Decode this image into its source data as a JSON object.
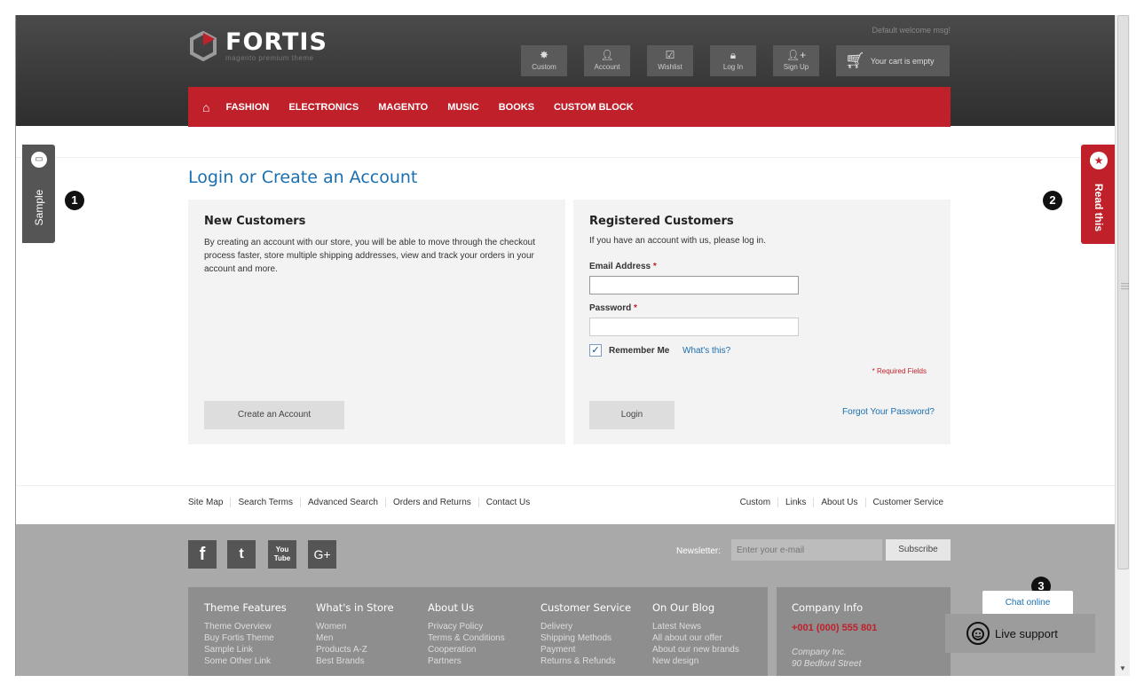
{
  "header": {
    "welcome": "Default welcome msg!",
    "logo_name": "FORTIS",
    "logo_tagline": "magento premium theme",
    "toolbar": [
      {
        "label": "Custom",
        "icon": "gear-icon"
      },
      {
        "label": "Account",
        "icon": "user-icon"
      },
      {
        "label": "Wishlist",
        "icon": "checkbox-icon"
      },
      {
        "label": "Log In",
        "icon": "lock-icon"
      },
      {
        "label": "Sign Up",
        "icon": "user-plus-icon"
      }
    ],
    "cart": "Your cart is empty"
  },
  "nav": {
    "items": [
      "FASHION",
      "ELECTRONICS",
      "MAGENTO",
      "MUSIC",
      "BOOKS",
      "CUSTOM BLOCK"
    ]
  },
  "side_tabs": {
    "sample": "Sample",
    "read": "Read this"
  },
  "badges": [
    "1",
    "2",
    "3"
  ],
  "page": {
    "title": "Login or Create an Account",
    "new_customers": {
      "heading": "New Customers",
      "description": "By creating an account with our store, you will be able to move through the checkout process faster, store multiple shipping addresses, view and track your orders in your account and more.",
      "button": "Create an Account"
    },
    "registered": {
      "heading": "Registered Customers",
      "description": "If you have an account with us, please log in.",
      "email_label": "Email Address",
      "email_value": "",
      "password_label": "Password",
      "required_mark": "*",
      "remember_label": "Remember Me",
      "remember_checked": true,
      "whats_this": "What's this?",
      "required_fields": "* Required Fields",
      "login_button": "Login",
      "forgot": "Forgot Your Password?"
    }
  },
  "footer_links": {
    "left": [
      "Site Map",
      "Search Terms",
      "Advanced Search",
      "Orders and Returns",
      "Contact Us"
    ],
    "right": [
      "Custom",
      "Links",
      "About Us",
      "Customer Service"
    ]
  },
  "footer": {
    "social": [
      "f",
      "t",
      "You Tube",
      "G+"
    ],
    "newsletter_label": "Newsletter:",
    "newsletter_placeholder": "Enter your e-mail",
    "subscribe": "Subscribe",
    "columns": [
      {
        "title": "Theme Features",
        "items": [
          "Theme Overview",
          "Buy Fortis Theme",
          "Sample Link",
          "Some Other Link"
        ]
      },
      {
        "title": "What's in Store",
        "items": [
          "Women",
          "Men",
          "Products A-Z",
          "Best Brands"
        ]
      },
      {
        "title": "About Us",
        "items": [
          "Privacy Policy",
          "Terms & Conditions",
          "Cooperation",
          "Partners"
        ]
      },
      {
        "title": "Customer Service",
        "items": [
          "Delivery",
          "Shipping Methods",
          "Payment",
          "Returns & Refunds"
        ]
      },
      {
        "title": "On Our Blog",
        "items": [
          "Latest News",
          "All about our offer",
          "About our new brands",
          "New design"
        ]
      }
    ],
    "company": {
      "title": "Company Info",
      "phone": "+001 (000) 555 801",
      "name": "Company Inc.",
      "street": "90 Bedford Street"
    }
  },
  "chat": {
    "bubble": "Chat online",
    "live_support": "Live support"
  },
  "colors": {
    "accent": "#c0202a",
    "link": "#1a6fb0",
    "header_bg": "#3f3f3f"
  }
}
